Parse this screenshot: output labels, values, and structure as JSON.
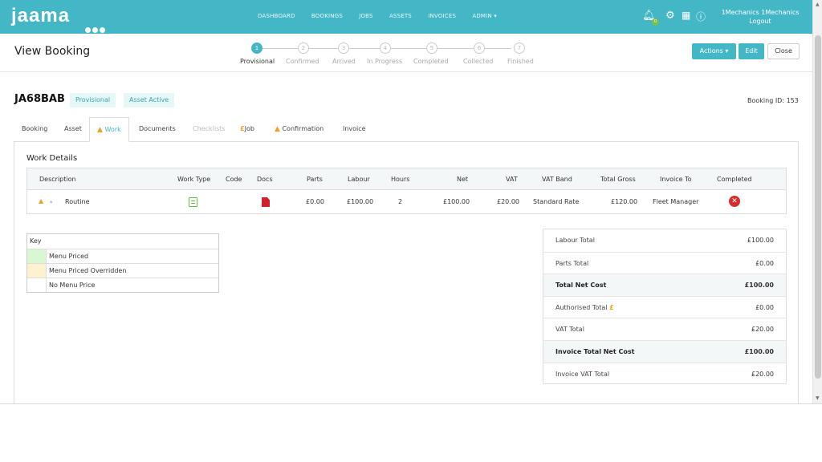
{
  "topnav": {
    "logo": "jaama",
    "links": [
      "DASHBOARD",
      "BOOKINGS",
      "JOBS",
      "ASSETS",
      "INVOICES",
      "ADMIN ▾"
    ],
    "notification_count": "0",
    "user_name": "1Mechanics 1Mechanics",
    "logout": "Logout"
  },
  "header": {
    "title": "View Booking",
    "steps": [
      {
        "num": "1",
        "label": "Provisional"
      },
      {
        "num": "2",
        "label": "Confirmed"
      },
      {
        "num": "3",
        "label": "Arrived"
      },
      {
        "num": "4",
        "label": "In Progress"
      },
      {
        "num": "5",
        "label": "Completed"
      },
      {
        "num": "6",
        "label": "Collected"
      },
      {
        "num": "7",
        "label": "Finished"
      }
    ],
    "active_step": 1,
    "buttons": {
      "actions": "Actions ▾",
      "edit": "Edit",
      "close": "Close"
    }
  },
  "booking": {
    "registration": "JA68BAB",
    "status_tag": "Provisional",
    "asset_tag": "Asset Active",
    "booking_id": "Booking ID: 153"
  },
  "tabs": [
    "Booking",
    "Asset",
    "Work",
    "Documents",
    "Checklists",
    "Job",
    "Confirmation",
    "Invoice"
  ],
  "tab_prefix": {
    "work": "▲",
    "job": "£",
    "confirmation": "▲"
  },
  "work": {
    "title": "Work Details",
    "columns": [
      "Description",
      "Work Type",
      "Code",
      "Docs",
      "Parts",
      "Labour",
      "Hours",
      "Net",
      "VAT",
      "VAT Band",
      "Total Gross",
      "Invoice To",
      "Completed"
    ],
    "row": {
      "warn": "▲",
      "arrow": "▴",
      "description": "Routine",
      "parts": "£0.00",
      "labour": "£100.00",
      "hours": "2",
      "net": "£100.00",
      "vat": "£20.00",
      "vat_band": "Standard Rate",
      "total_gross": "£120.00",
      "invoice_to": "Fleet Manager",
      "completed_icon": "✕"
    }
  },
  "key": {
    "title": "Key",
    "rows": [
      {
        "label": "Menu Priced",
        "color": "#d9f7d2"
      },
      {
        "label": "Menu Priced Overridden",
        "color": "#fdf2cf"
      },
      {
        "label": "No Menu Price",
        "color": "#ffffff"
      }
    ]
  },
  "totals": [
    {
      "label": "Labour Total",
      "value": "£100.00",
      "strong": false
    },
    {
      "label": "Parts Total",
      "value": "£0.00",
      "strong": false
    },
    {
      "label": "Total Net Cost",
      "value": "£100.00",
      "strong": true
    },
    {
      "label": "Authorised Total",
      "value": "£0.00",
      "strong": false,
      "suffix": "£"
    },
    {
      "label": "VAT Total",
      "value": "£20.00",
      "strong": false
    },
    {
      "label": "Invoice Total Net Cost",
      "value": "£100.00",
      "strong": true
    },
    {
      "label": "Invoice VAT Total",
      "value": "£20.00",
      "strong": false
    }
  ]
}
